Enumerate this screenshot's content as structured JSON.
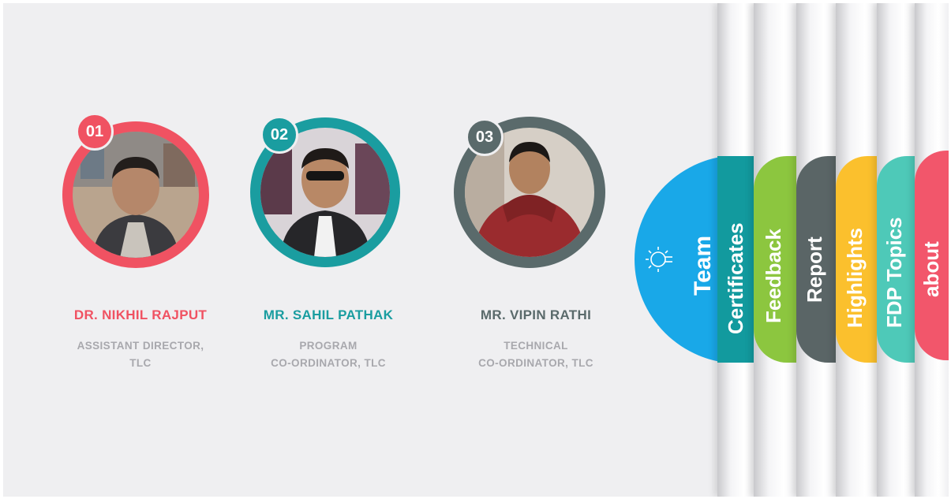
{
  "team": [
    {
      "number": "01",
      "name": "DR. NIKHIL RAJPUT",
      "role_line1": "ASSISTANT DIRECTOR,",
      "role_line2": "TLC",
      "color": "#f05262"
    },
    {
      "number": "02",
      "name": "MR. SAHIL PATHAK",
      "role_line1": "PROGRAM",
      "role_line2": "CO-ORDINATOR, TLC",
      "color": "#1a9da0"
    },
    {
      "number": "03",
      "name": "MR. VIPIN RATHI",
      "role_line1": "TECHNICAL",
      "role_line2": "CO-ORDINATOR, TLC",
      "color": "#5a6a6b"
    }
  ],
  "tabs": [
    {
      "label": "Team",
      "color": "#19a8e8",
      "icon": "lightbulb-icon"
    },
    {
      "label": "Certificates",
      "color": "#129a9e"
    },
    {
      "label": "Feedback",
      "color": "#8cc63f"
    },
    {
      "label": "Report",
      "color": "#5a6566"
    },
    {
      "label": "Highlights",
      "color": "#fbc02d"
    },
    {
      "label": "FDP Topics",
      "color": "#4ec9b8"
    },
    {
      "label": "about",
      "color": "#f2566b"
    }
  ]
}
